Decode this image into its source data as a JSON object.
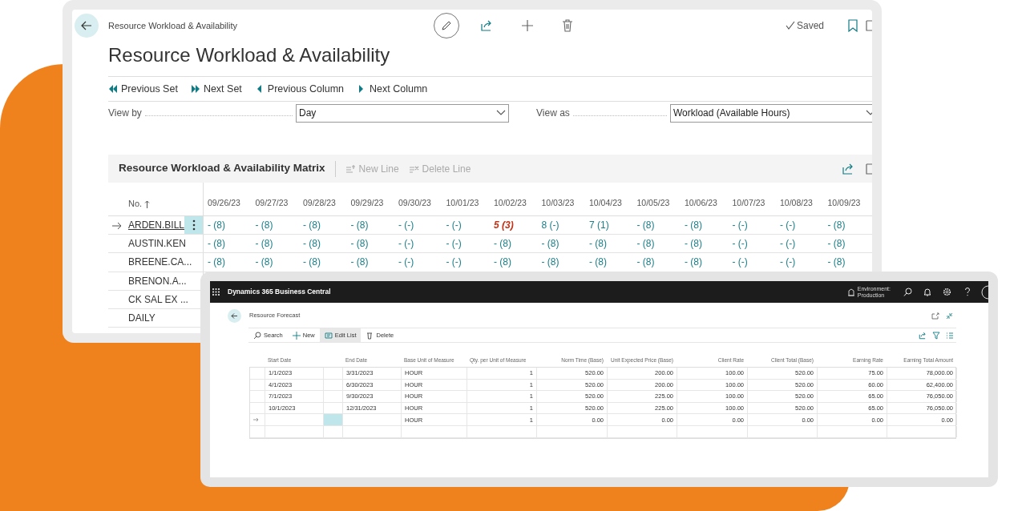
{
  "workload_window": {
    "breadcrumb": "Resource Workload & Availability",
    "status": "Saved",
    "title": "Resource Workload & Availability",
    "actions": [
      {
        "kind": "first",
        "label": "Previous Set"
      },
      {
        "kind": "last",
        "label": "Next Set"
      },
      {
        "kind": "prev",
        "label": "Previous Column"
      },
      {
        "kind": "next",
        "label": "Next Column"
      }
    ],
    "view_by": {
      "label": "View by",
      "value": "Day"
    },
    "view_as": {
      "label": "View as",
      "value": "Workload (Available Hours)"
    },
    "matrix": {
      "title": "Resource Workload & Availability Matrix",
      "actions": [
        {
          "kind": "new",
          "label": "New Line",
          "disabled": true
        },
        {
          "kind": "delete",
          "label": "Delete Line",
          "disabled": true
        }
      ],
      "first_column": "No.",
      "dates": [
        "09/26/23",
        "09/27/23",
        "09/28/23",
        "09/29/23",
        "09/30/23",
        "10/01/23",
        "10/02/23",
        "10/03/23",
        "10/04/23",
        "10/05/23",
        "10/06/23",
        "10/07/23",
        "10/08/23",
        "10/09/23"
      ],
      "rows": [
        {
          "no": "ARDEN.BILL",
          "current": true,
          "cells": [
            {
              "value": "- (8)",
              "kind": "normal"
            },
            {
              "value": "- (8)",
              "kind": "normal"
            },
            {
              "value": "- (8)",
              "kind": "normal"
            },
            {
              "value": "- (8)",
              "kind": "normal"
            },
            {
              "value": "- (-)",
              "kind": "normal"
            },
            {
              "value": "- (-)",
              "kind": "normal"
            },
            {
              "value": "5 (3)",
              "kind": "alert"
            },
            {
              "value": "8 (-)",
              "kind": "normal"
            },
            {
              "value": "7 (1)",
              "kind": "normal"
            },
            {
              "value": "- (8)",
              "kind": "normal"
            },
            {
              "value": "- (8)",
              "kind": "normal"
            },
            {
              "value": "- (-)",
              "kind": "normal"
            },
            {
              "value": "- (-)",
              "kind": "normal"
            },
            {
              "value": "- (8)",
              "kind": "normal"
            }
          ]
        },
        {
          "no": "AUSTIN.KEN",
          "current": false,
          "cells": [
            {
              "value": "- (8)",
              "kind": "normal"
            },
            {
              "value": "- (8)",
              "kind": "normal"
            },
            {
              "value": "- (8)",
              "kind": "normal"
            },
            {
              "value": "- (8)",
              "kind": "normal"
            },
            {
              "value": "- (-)",
              "kind": "normal"
            },
            {
              "value": "- (-)",
              "kind": "normal"
            },
            {
              "value": "- (8)",
              "kind": "normal"
            },
            {
              "value": "- (8)",
              "kind": "normal"
            },
            {
              "value": "- (8)",
              "kind": "normal"
            },
            {
              "value": "- (8)",
              "kind": "normal"
            },
            {
              "value": "- (8)",
              "kind": "normal"
            },
            {
              "value": "- (-)",
              "kind": "normal"
            },
            {
              "value": "- (-)",
              "kind": "normal"
            },
            {
              "value": "- (8)",
              "kind": "normal"
            }
          ]
        },
        {
          "no": "BREENE.CA...",
          "current": false,
          "cells": [
            {
              "value": "- (8)",
              "kind": "normal"
            },
            {
              "value": "- (8)",
              "kind": "normal"
            },
            {
              "value": "- (8)",
              "kind": "normal"
            },
            {
              "value": "- (8)",
              "kind": "normal"
            },
            {
              "value": "- (-)",
              "kind": "normal"
            },
            {
              "value": "- (-)",
              "kind": "normal"
            },
            {
              "value": "- (8)",
              "kind": "normal"
            },
            {
              "value": "- (8)",
              "kind": "normal"
            },
            {
              "value": "- (8)",
              "kind": "normal"
            },
            {
              "value": "- (8)",
              "kind": "normal"
            },
            {
              "value": "- (8)",
              "kind": "normal"
            },
            {
              "value": "- (-)",
              "kind": "normal"
            },
            {
              "value": "- (-)",
              "kind": "normal"
            },
            {
              "value": "- (8)",
              "kind": "normal"
            }
          ]
        },
        {
          "no": "BRENON.A...",
          "current": false
        },
        {
          "no": "CK SAL EX ...",
          "current": false
        },
        {
          "no": "DAILY",
          "current": false
        }
      ]
    }
  },
  "forecast_window": {
    "app_title": "Dynamics 365 Business Central",
    "environment": [
      "Environment:",
      "Production"
    ],
    "page_title": "Resource Forecast",
    "actions": [
      {
        "kind": "search",
        "label": "Search",
        "selected": false
      },
      {
        "kind": "new",
        "label": "New",
        "selected": false
      },
      {
        "kind": "edit",
        "label": "Edit List",
        "selected": true
      },
      {
        "kind": "delete",
        "label": "Delete",
        "selected": false
      }
    ],
    "columns": [
      "Start Date",
      "End Date",
      "Base Unit of Measure",
      "Qty. per Unit of Measure",
      "Norm Time (Base)",
      "Unit Expected Price (Base)",
      "Client Rate",
      "Client Total (Base)",
      "Earning Rate",
      "Earning Total Amount"
    ],
    "rows": [
      {
        "current": false,
        "start_date": "1/1/2023",
        "end_date": "3/31/2023",
        "unit": "HOUR",
        "qty": "1",
        "norm_time": "520.00",
        "unit_price": "200.00",
        "client_rate": "100.00",
        "client_total": "520.00",
        "earning_rate": "75.00",
        "earning_total": "78,000.00"
      },
      {
        "current": false,
        "start_date": "4/1/2023",
        "end_date": "6/30/2023",
        "unit": "HOUR",
        "qty": "1",
        "norm_time": "520.00",
        "unit_price": "200.00",
        "client_rate": "100.00",
        "client_total": "520.00",
        "earning_rate": "60.00",
        "earning_total": "62,400.00"
      },
      {
        "current": false,
        "start_date": "7/1/2023",
        "end_date": "9/30/2023",
        "unit": "HOUR",
        "qty": "1",
        "norm_time": "520.00",
        "unit_price": "225.00",
        "client_rate": "100.00",
        "client_total": "520.00",
        "earning_rate": "65.00",
        "earning_total": "76,050.00"
      },
      {
        "current": false,
        "start_date": "10/1/2023",
        "end_date": "12/31/2023",
        "unit": "HOUR",
        "qty": "1",
        "norm_time": "520.00",
        "unit_price": "225.00",
        "client_rate": "100.00",
        "client_total": "520.00",
        "earning_rate": "65.00",
        "earning_total": "76,050.00"
      },
      {
        "current": true,
        "unit": "HOUR",
        "qty": "1",
        "norm_time": "0.00",
        "unit_price": "0.00",
        "client_rate": "0.00",
        "client_total": "0.00",
        "earning_rate": "0.00",
        "earning_total": "0.00"
      },
      {
        "current": false
      }
    ]
  }
}
